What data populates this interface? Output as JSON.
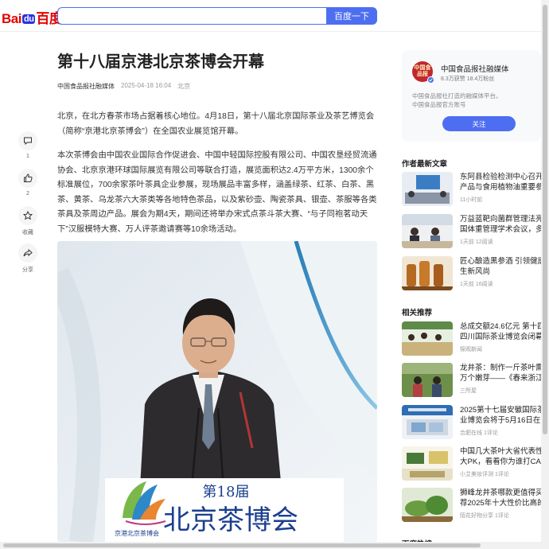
{
  "header": {
    "logo_bai": "Bai",
    "logo_du": "du",
    "logo_baidu": "百度",
    "search_button": "百度一下",
    "search_value": ""
  },
  "article": {
    "title": "第十八届京港北京茶博会开幕",
    "source": "中国食品报社融媒体",
    "datetime": "2025-04-18 16:04",
    "location": "北京",
    "paragraph1": "北京，在北方春茶市场占据着核心地位。4月18日，第十八届北京国际茶业及茶艺博览会（简称“京港北京茶博会”）在全国农业展览馆开幕。",
    "paragraph2": "本次茶博会由中国农业国际合作促进会、中国中轻国际控股有限公司、中国农垦经贸流通协会、北京京港环球国际展览有限公司等联合打造，展览面积达2.4万平方米，1300余个标准展位，700余家茶叶茶具企业参展，现场展品丰富多样，涵盖绿茶、红茶、白茶、黑茶、黄茶、乌龙茶六大茶类等各地特色茶品，以及紫砂壶、陶瓷茶具、银壶、茶服等各类茶具及茶周边产品。展会为期4天，期间还将举办宋式点茶斗茶大赛、“与子同袍茗动天下”汉服模特大赛、万人评茶邀请赛等10余场活动。",
    "photo_banner_top": "第18届",
    "photo_banner_main": "北京茶博会",
    "photo_banner_small": "京港北京茶博会"
  },
  "actions": [
    {
      "label": "1",
      "icon": "comment-icon"
    },
    {
      "label": "2",
      "icon": "thumbs-up-icon"
    },
    {
      "label": "收藏",
      "icon": "star-icon"
    },
    {
      "label": "分享",
      "icon": "share-icon"
    }
  ],
  "author": {
    "avatar_text": "中国食品报",
    "name": "中国食品报社融媒体",
    "fans": "8.3万获赞",
    "likes": "18.4万粉丝",
    "desc1": "中国食品报社打造的融媒体平台。",
    "desc2": "中国食品报官方账号",
    "follow": "关注"
  },
  "latest": {
    "title": "作者最新文章",
    "items": [
      {
        "title": "东阿县检验检测中心召开\n产品与食用植物油重要参",
        "meta": "11小时前"
      },
      {
        "title": "万益蓝靶向菌群管理法亮\n国体重管理学术会议，多",
        "meta": "1天前  12阅读"
      },
      {
        "title": "匠心酿造黑参酒 引领健康\n生新风尚",
        "meta": "1天前  16阅读"
      }
    ]
  },
  "related": {
    "title": "相关推荐",
    "items": [
      {
        "title": "总成交额24.6亿元 第十四\n四川国际茶业博览会闭幕",
        "meta": "锦观新闻"
      },
      {
        "title": "龙井茶：制作一斤茶叶需要\n万个嫩芽——《春来浙江》",
        "meta": "三所屋"
      },
      {
        "title": "2025第十七届安徽国际茶\n业博览会将于5月16日在合",
        "meta": "合肥在线  1评论"
      },
      {
        "title": "中国几大茶叶大省代表性\n大PK，看看你为谁打CAL",
        "meta": "小艾美妆评测  1评论"
      },
      {
        "title": "狮峰龙井茶哪款更值得买\n荐2025年十大性价比高的",
        "meta": "陌花好物分享  1评论"
      }
    ],
    "next_section_partial": "百度热搜"
  },
  "colors": {
    "accent": "#4e6ef2",
    "logo_red": "#e10602",
    "logo_blue": "#2932e1"
  }
}
